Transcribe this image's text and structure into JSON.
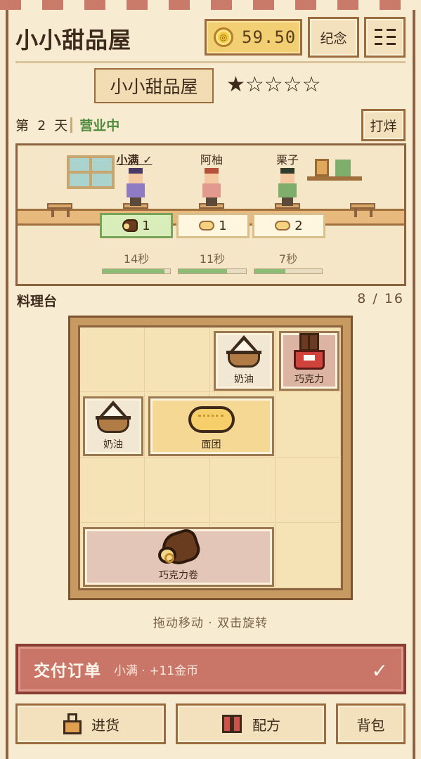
{
  "header": {
    "title": "小小甜品屋",
    "coins": "59.50",
    "memorial_label": "纪念",
    "menu_icon": "menu-icon"
  },
  "shop": {
    "name": "小小甜品屋",
    "rating": 1,
    "rating_max": 5,
    "stars": "★☆☆☆☆"
  },
  "status": {
    "day_prefix": "第",
    "day_number": "2",
    "day_suffix": "天",
    "state": "营业中",
    "close_label": "打烊"
  },
  "customers": [
    {
      "name": "小满 ✓",
      "order_icon": "chocolate-roll",
      "quantity": "1",
      "timer": "14秒",
      "progress": 0.92,
      "ready": true,
      "hair": "#4a3a66",
      "shirt": "#8e7bc4"
    },
    {
      "name": "阿柚",
      "order_icon": "dough",
      "quantity": "1",
      "timer": "11秒",
      "progress": 0.72,
      "ready": false,
      "hair": "#b5503a",
      "shirt": "#e39a8e"
    },
    {
      "name": "栗子",
      "order_icon": "dough",
      "quantity": "2",
      "timer": "7秒",
      "progress": 0.46,
      "ready": false,
      "hair": "#2e3a2a",
      "shirt": "#7fae6c"
    }
  ],
  "station": {
    "title": "料理台",
    "count": "8 / 16",
    "items": [
      {
        "label": "奶油",
        "type": "cream"
      },
      {
        "label": "巧克力",
        "type": "chocolate"
      },
      {
        "label": "奶油",
        "type": "cream"
      },
      {
        "label": "面团",
        "type": "dough"
      },
      {
        "label": "巧克力卷",
        "type": "chocolate-roll"
      }
    ],
    "hint": "拖动移动 · 双击旋转"
  },
  "deliver": {
    "label": "交付订单",
    "detail": "小满 · +11金币",
    "check": "✓"
  },
  "bottom": {
    "stock": "进货",
    "recipe": "配方",
    "bag": "背包"
  }
}
